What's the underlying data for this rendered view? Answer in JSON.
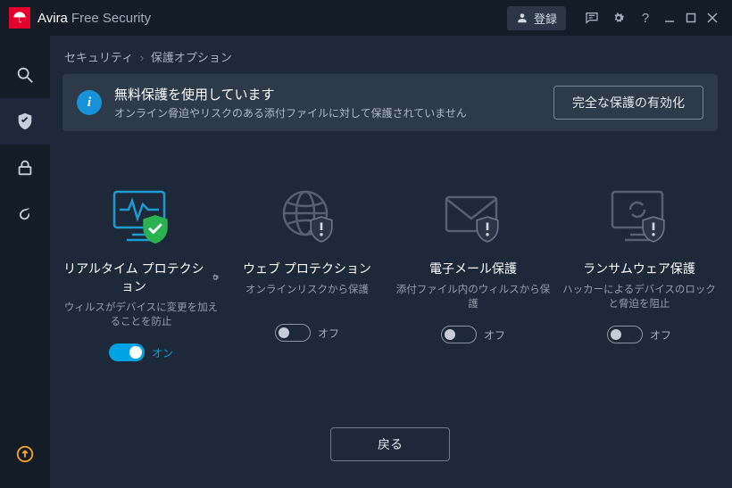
{
  "app": {
    "brand": "Avira",
    "product": "Free Security"
  },
  "titlebar": {
    "login_label": "登録"
  },
  "breadcrumb": {
    "parent": "セキュリティ",
    "current": "保護オプション"
  },
  "banner": {
    "title": "無料保護を使用しています",
    "subtitle": "オンライン脅迫やリスクのある添付ファイルに対して保護されていません",
    "cta": "完全な保護の有効化"
  },
  "toggle_labels": {
    "on": "オン",
    "off": "オフ"
  },
  "cards": [
    {
      "title": "リアルタイム プロテクション",
      "desc": "ウィルスがデバイスに変更を加えることを防止",
      "state": "on",
      "has_settings": true
    },
    {
      "title": "ウェブ プロテクション",
      "desc": "オンラインリスクから保護",
      "state": "off",
      "has_settings": false
    },
    {
      "title": "電子メール保護",
      "desc": "添付ファイル内のウィルスから保護",
      "state": "off",
      "has_settings": false
    },
    {
      "title": "ランサムウェア保護",
      "desc": "ハッカーによるデバイスのロックと脅迫を阻止",
      "state": "off",
      "has_settings": false
    }
  ],
  "back_label": "戻る"
}
